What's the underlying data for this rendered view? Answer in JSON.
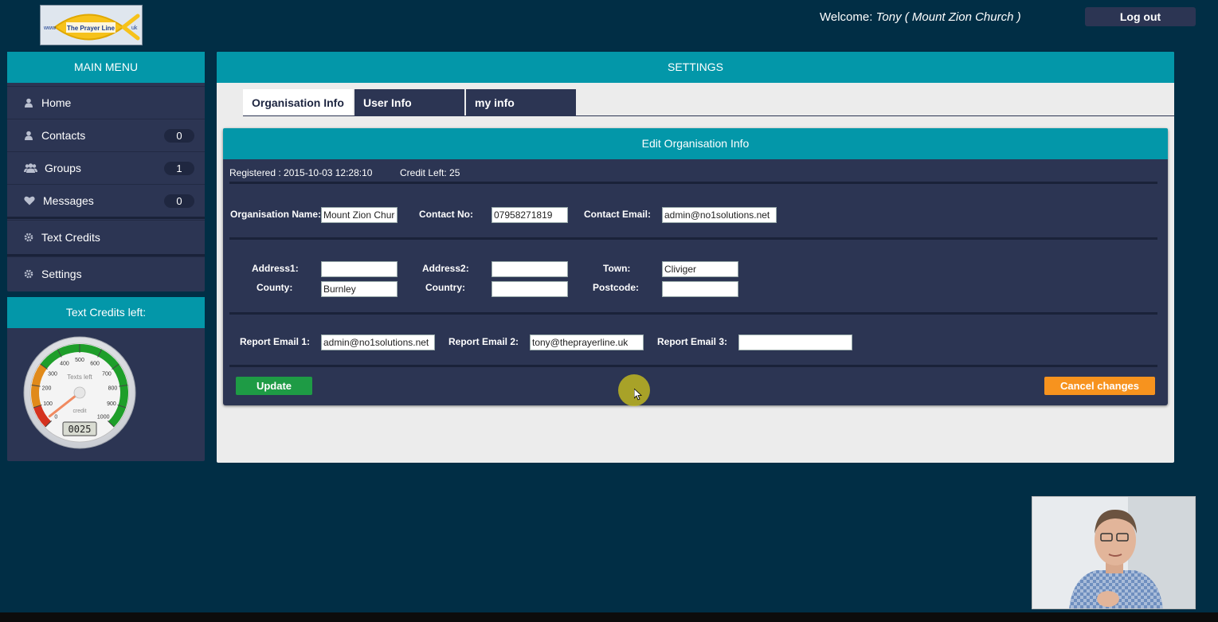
{
  "header": {
    "logo_text": "The Prayer Line",
    "logo_prefix": "www",
    "logo_suffix": "uk",
    "welcome_label": "Welcome:",
    "welcome_user": "Tony ( Mount Zion Church )",
    "logout_label": "Log out"
  },
  "sidebar": {
    "title": "MAIN MENU",
    "items": [
      {
        "label": "Home",
        "icon": "user-icon"
      },
      {
        "label": "Contacts",
        "icon": "user-icon",
        "count": "0"
      },
      {
        "label": "Groups",
        "icon": "group-icon",
        "count": "1"
      },
      {
        "label": "Messages",
        "icon": "heart-icon",
        "count": "0"
      },
      {
        "label": "Text Credits",
        "icon": "gear-icon"
      },
      {
        "label": "Settings",
        "icon": "gear-icon"
      }
    ]
  },
  "credits_panel": {
    "title": "Text Credits left:",
    "gauge": {
      "inner_label": "Texts left",
      "sub_label": "credit",
      "counter": "0025",
      "value": 25,
      "min": 0,
      "max": 1000,
      "ticks": [
        "0",
        "100",
        "200",
        "300",
        "400",
        "500",
        "600",
        "700",
        "800",
        "900",
        "1000"
      ]
    }
  },
  "settings": {
    "title": "SETTINGS",
    "tabs": [
      {
        "label": "Organisation Info",
        "active": true
      },
      {
        "label": "User Info",
        "active": false
      },
      {
        "label": "my info",
        "active": false
      }
    ],
    "edit": {
      "title": "Edit Organisation Info",
      "registered": "Registered : 2015-10-03 12:28:10",
      "credit_left": "Credit Left: 25",
      "fields": {
        "org_name": {
          "label": "Organisation Name:",
          "value": "Mount Zion Church"
        },
        "contact_no": {
          "label": "Contact No:",
          "value": "07958271819"
        },
        "contact_email": {
          "label": "Contact Email:",
          "value": "admin@no1solutions.net"
        },
        "address1": {
          "label": "Address1:",
          "value": ""
        },
        "address2": {
          "label": "Address2:",
          "value": ""
        },
        "town": {
          "label": "Town:",
          "value": "Cliviger"
        },
        "county": {
          "label": "County:",
          "value": "Burnley"
        },
        "country": {
          "label": "Country:",
          "value": ""
        },
        "postcode": {
          "label": "Postcode:",
          "value": ""
        },
        "report1": {
          "label": "Report Email 1:",
          "value": "admin@no1solutions.net"
        },
        "report2": {
          "label": "Report Email 2:",
          "value": "tony@theprayerline.uk"
        },
        "report3": {
          "label": "Report Email 3:",
          "value": ""
        }
      },
      "update_label": "Update",
      "cancel_label": "Cancel changes"
    }
  },
  "colors": {
    "background": "#012e45",
    "panel": "#2c3553",
    "accent": "#0397a9",
    "update": "#1e9b45",
    "cancel": "#f7931e"
  }
}
